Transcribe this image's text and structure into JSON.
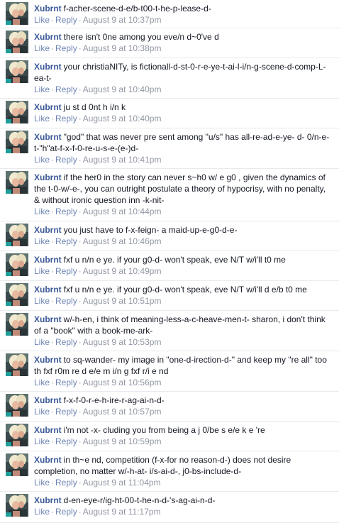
{
  "actions": {
    "like": "Like",
    "reply": "Reply",
    "separator": "·"
  },
  "comments": [
    {
      "author": "Xubrnt",
      "text": "f-acher-scene-d-e/b-t00-t-he-p-lease-d-",
      "time": "August 9 at 10:37pm"
    },
    {
      "author": "Xubrnt",
      "text": "there isn't 0ne among you eve/n d~0've d",
      "time": "August 9 at 10:38pm"
    },
    {
      "author": "Xubrnt",
      "text": "your christiaNITy, is fictionall-d-st-0-r-e-ye-t-ai-l-i/n-g-scene-d-comp-L-ea-t-",
      "time": "August 9 at 10:40pm"
    },
    {
      "author": "Xubrnt",
      "text": "ju st d 0nt h i/n k",
      "time": "August 9 at 10:40pm"
    },
    {
      "author": "Xubrnt",
      "text": "\"god\" that was never pre sent among \"u/s\" has all-re-ad-e-ye- d- 0/n-e-t-\"h\"at-f-x-f-0-re-u-s-e-(e-)d-",
      "time": "August 9 at 10:41pm"
    },
    {
      "author": "Xubrnt",
      "text": "if the her0 in the story can never s~h0 w/ e g0 , given the dynamics of the t-0-w/-e-, you can outright postulate a theory of hypocrisy, with no penalty, & without ironic question inn -k-nit-",
      "time": "August 9 at 10:44pm"
    },
    {
      "author": "Xubrnt",
      "text": "you just have to f-x-feign- a maid-up-e-g0-d-e-",
      "time": "August 9 at 10:46pm"
    },
    {
      "author": "Xubrnt",
      "text": "fxf u n/n e ye. if your g0-d- won't speak, eve N/T w/i'll t0 me",
      "time": "August 9 at 10:49pm"
    },
    {
      "author": "Xubrnt",
      "text": "fxf u n/n e ye. if your g0-d- won't speak, eve N/T w/i'll d e/b t0 me",
      "time": "August 9 at 10:51pm"
    },
    {
      "author": "Xubrnt",
      "text": "w/-h-en, i think of meaning-less-a-c-heave-men-t- sharon, i don't think of a \"book\" with a book-me-ark-",
      "time": "August 9 at 10:53pm"
    },
    {
      "author": "Xubrnt",
      "text": "to sq-wander- my image in \"one-d-irection-d-\" and keep my \"re all\" too th fxf r0m re d e/e m i/n g fxf r/i e nd",
      "time": "August 9 at 10:56pm"
    },
    {
      "author": "Xubrnt",
      "text": "f-x-f-0-r-e-h-ire-r-ag-ai-n-d-",
      "time": "August 9 at 10:57pm"
    },
    {
      "author": "Xubrnt",
      "text": "i'm not -x- cluding you from being a j 0/be s e/e k e 're",
      "time": "August 9 at 10:59pm"
    },
    {
      "author": "Xubrnt",
      "text": "in th~e nd, competition (f-x-for no reason-d-) does not desire completion, no matter w/-h-at- i/s-ai-d-, j0-bs-include-d-",
      "time": "August 9 at 11:04pm"
    },
    {
      "author": "Xubrnt",
      "text": "d-en-eye-r/ig-ht-00-t-he-n-d-'s-ag-ai-n-d-",
      "time": "August 9 at 11:17pm"
    }
  ]
}
